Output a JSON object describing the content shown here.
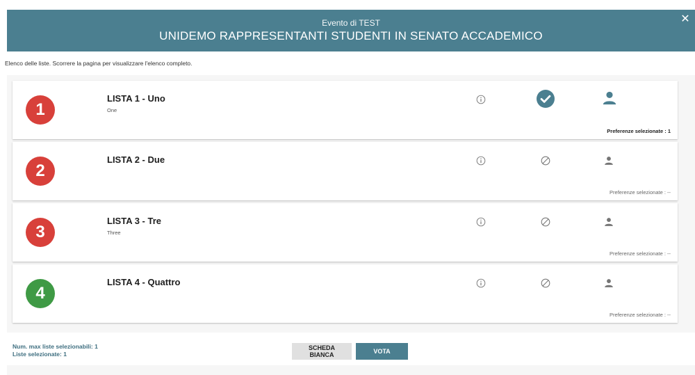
{
  "header": {
    "subtitle": "Evento di TEST",
    "title": "UNIDEMO RAPPRESENTANTI STUDENTI IN SENATO ACCADEMICO",
    "close_label": "✕"
  },
  "instructions": "Elenco delle liste. Scorrere la pagina per visualizzare l'elenco completo.",
  "lists": [
    {
      "number": "1",
      "name": "LISTA 1 - Uno",
      "subtitle": "One",
      "badge_color": "#d8403a",
      "selected": true,
      "preferences_label": "Preferenze selezionate : 1"
    },
    {
      "number": "2",
      "name": "LISTA 2 - Due",
      "subtitle": "",
      "badge_color": "#d8403a",
      "selected": false,
      "preferences_label": "Preferenze selezionate : --"
    },
    {
      "number": "3",
      "name": "LISTA 3 - Tre",
      "subtitle": "Three",
      "badge_color": "#d8403a",
      "selected": false,
      "preferences_label": "Preferenze selezionate : --"
    },
    {
      "number": "4",
      "name": "LISTA 4 - Quattro",
      "subtitle": "",
      "badge_color": "#3f9a45",
      "selected": false,
      "preferences_label": "Preferenze selezionate : --"
    }
  ],
  "footer": {
    "max_lists": "Num. max liste selezionabili: 1",
    "selected_lists": "Liste selezionate: 1",
    "blank_button": "SCHEDA BIANCA",
    "vote_button": "VOTA"
  },
  "colors": {
    "primary": "#4b7f90",
    "badge_red": "#d8403a",
    "badge_green": "#3f9a45",
    "icon_gray": "#757575"
  },
  "icons": {
    "info": "info-icon",
    "selected": "check-circle-icon",
    "not_selected": "no-selection-icon",
    "preferences": "person-icon",
    "close": "close-icon"
  }
}
